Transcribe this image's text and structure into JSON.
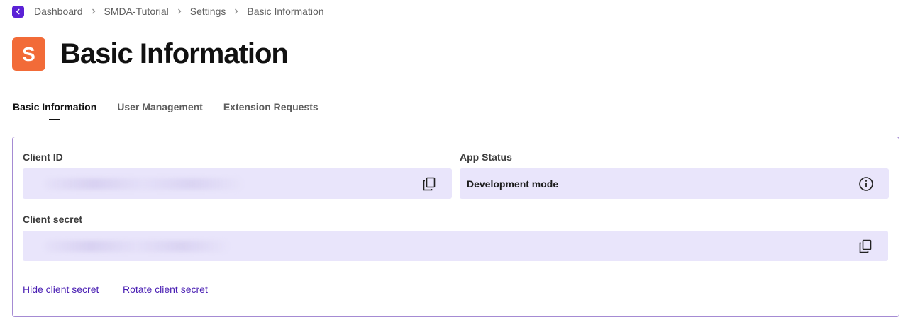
{
  "breadcrumb": {
    "items": [
      "Dashboard",
      "SMDA-Tutorial",
      "Settings",
      "Basic Information"
    ]
  },
  "header": {
    "avatar_letter": "S",
    "title": "Basic Information"
  },
  "tabs": [
    {
      "label": "Basic Information",
      "active": true
    },
    {
      "label": "User Management",
      "active": false
    },
    {
      "label": "Extension Requests",
      "active": false
    }
  ],
  "card": {
    "client_id_label": "Client ID",
    "app_status_label": "App Status",
    "app_status_value": "Development mode",
    "client_secret_label": "Client secret",
    "hide_secret_link": "Hide client secret",
    "rotate_secret_link": "Rotate client secret"
  },
  "colors": {
    "accent": "#5b21d6",
    "avatar": "#f26b38",
    "field_bg": "#e9e5fb",
    "card_border": "#a58bd3",
    "link": "#4a1fb3"
  },
  "icons": [
    "chevron-left-icon",
    "chevron-right-icon",
    "copy-icon",
    "info-icon"
  ]
}
